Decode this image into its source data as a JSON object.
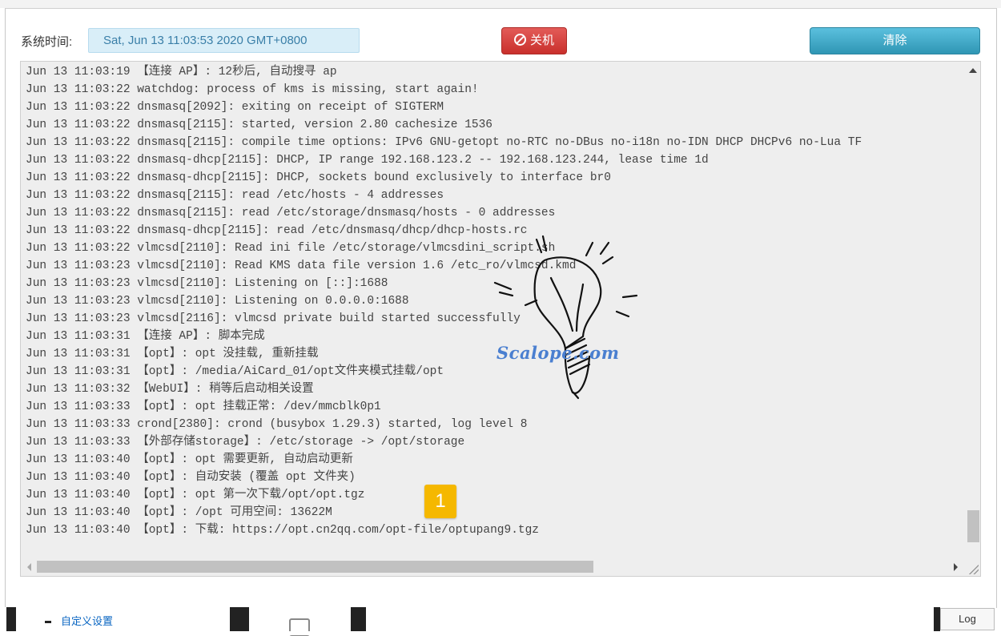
{
  "header": {
    "system_time_label": "系统时间:",
    "system_time_value": "Sat, Jun 13 11:03:53 2020 GMT+0800",
    "shutdown_label": "关机",
    "clear_label": "清除"
  },
  "log": {
    "lines": [
      "Jun 13 11:03:19 【连接 AP】: 12秒后, 自动搜寻 ap",
      "Jun 13 11:03:22 watchdog: process of kms is missing, start again!",
      "Jun 13 11:03:22 dnsmasq[2092]: exiting on receipt of SIGTERM",
      "Jun 13 11:03:22 dnsmasq[2115]: started, version 2.80 cachesize 1536",
      "Jun 13 11:03:22 dnsmasq[2115]: compile time options: IPv6 GNU-getopt no-RTC no-DBus no-i18n no-IDN DHCP DHCPv6 no-Lua TF",
      "Jun 13 11:03:22 dnsmasq-dhcp[2115]: DHCP, IP range 192.168.123.2 -- 192.168.123.244, lease time 1d",
      "Jun 13 11:03:22 dnsmasq-dhcp[2115]: DHCP, sockets bound exclusively to interface br0",
      "Jun 13 11:03:22 dnsmasq[2115]: read /etc/hosts - 4 addresses",
      "Jun 13 11:03:22 dnsmasq[2115]: read /etc/storage/dnsmasq/hosts - 0 addresses",
      "Jun 13 11:03:22 dnsmasq-dhcp[2115]: read /etc/dnsmasq/dhcp/dhcp-hosts.rc",
      "Jun 13 11:03:22 vlmcsd[2110]: Read ini file /etc/storage/vlmcsdini_script.sh",
      "Jun 13 11:03:23 vlmcsd[2110]: Read KMS data file version 1.6 /etc_ro/vlmcsd.kmd",
      "Jun 13 11:03:23 vlmcsd[2110]: Listening on [::]:1688",
      "Jun 13 11:03:23 vlmcsd[2110]: Listening on 0.0.0.0:1688",
      "Jun 13 11:03:23 vlmcsd[2116]: vlmcsd private build started successfully",
      "Jun 13 11:03:31 【连接 AP】: 脚本完成",
      "Jun 13 11:03:31 【opt】: opt 没挂载, 重新挂载",
      "Jun 13 11:03:31 【opt】: /media/AiCard_01/opt文件夹模式挂载/opt",
      "Jun 13 11:03:32 【WebUI】: 稍等后启动相关设置",
      "Jun 13 11:03:33 【opt】: opt 挂载正常: /dev/mmcblk0p1",
      "Jun 13 11:03:33 crond[2380]: crond (busybox 1.29.3) started, log level 8",
      "Jun 13 11:03:33 【外部存储storage】: /etc/storage -> /opt/storage",
      "Jun 13 11:03:40 【opt】: opt 需要更新, 自动启动更新",
      "Jun 13 11:03:40 【opt】: 自动安装 (覆盖 opt 文件夹)",
      "Jun 13 11:03:40 【opt】: opt 第一次下载/opt/opt.tgz",
      "Jun 13 11:03:40 【opt】: /opt 可用空间: 13622M",
      "Jun 13 11:03:40 【opt】: 下载: https://opt.cn2qq.com/opt-file/optupang9.tgz"
    ]
  },
  "overlay": {
    "badge_number": "1",
    "watermark_text": "Scalope.com",
    "badge_color": "#f5b800",
    "watermark_color": "#4a7fd0"
  },
  "footer": {
    "custom_settings_label": "自定义设置",
    "log_tab_label": "Log"
  },
  "colors": {
    "shutdown_red": "#d9534f",
    "clear_blue": "#3aa8cf",
    "time_box_bg": "#d9eef8"
  }
}
